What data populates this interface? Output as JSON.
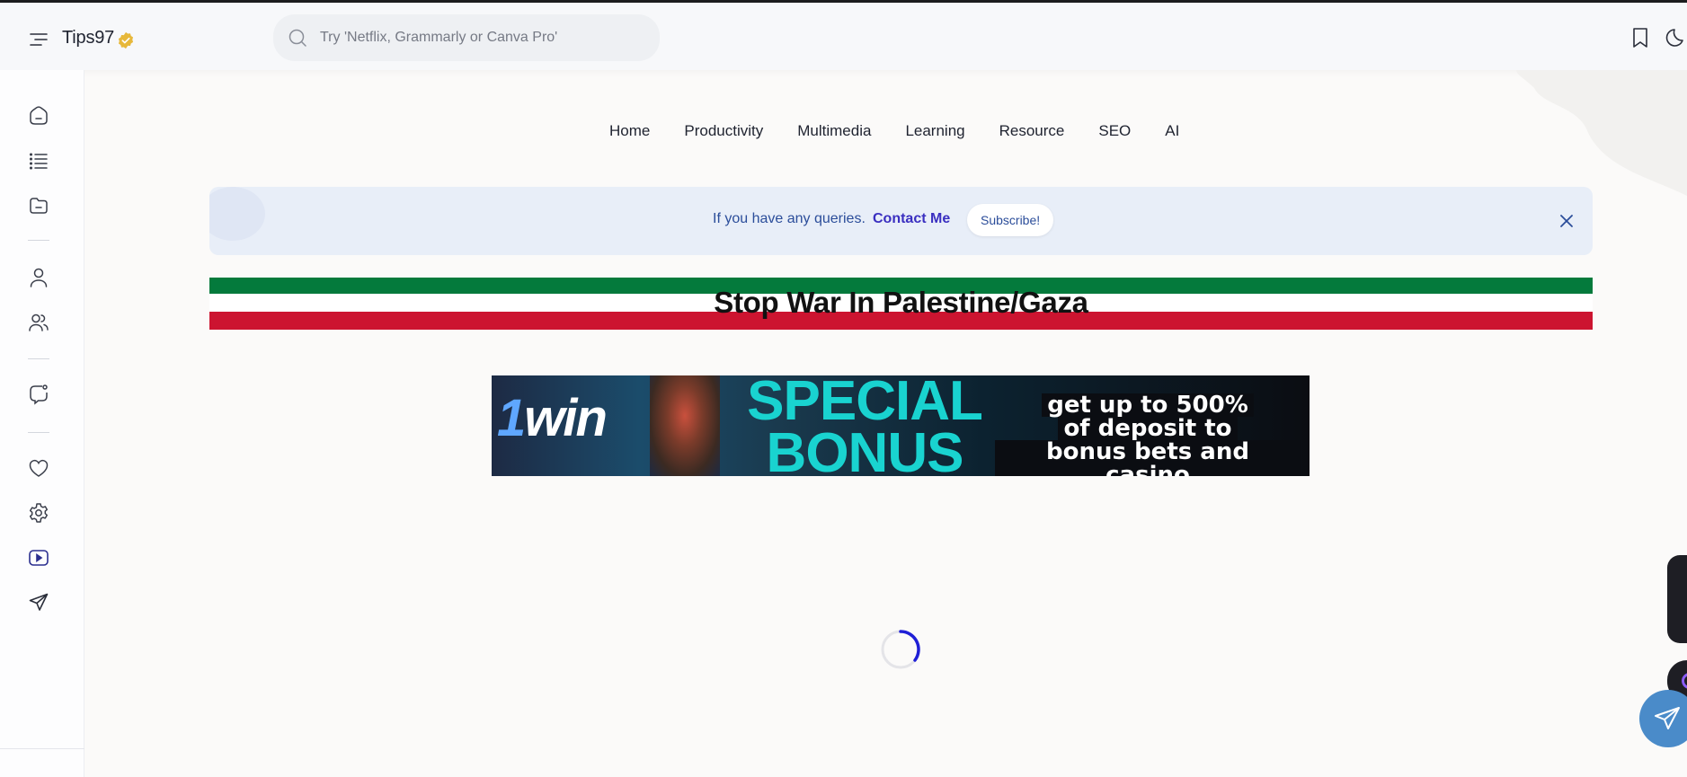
{
  "header": {
    "brand": "Tips97",
    "search_placeholder": "Try 'Netflix, Grammarly or Canva Pro'"
  },
  "nav": {
    "items": [
      "Home",
      "Productivity",
      "Multimedia",
      "Learning",
      "Resource",
      "SEO",
      "AI"
    ]
  },
  "notice": {
    "text": "If you have any queries.",
    "link": "Contact Me",
    "subscribe": "Subscribe!"
  },
  "banner": {
    "title": "Stop War In Palestine/Gaza"
  },
  "ad": {
    "logo_num": "1",
    "logo_word": "win",
    "headline_1": "SPECIAL",
    "headline_2": "BONUS",
    "line_1": "get up to 500%",
    "line_2": "of deposit to",
    "line_3": "bonus bets and casino"
  },
  "colors": {
    "accent": "#3a2fc0",
    "notice_bg": "#e8eef8",
    "flag_green": "#047a3c",
    "flag_red": "#cc1430",
    "spinner": "#1f1fd6",
    "telegram": "#4a8bc9"
  },
  "icons": {
    "header": [
      "menu-icon",
      "verified-badge-icon",
      "search-icon",
      "bookmark-icon",
      "moon-icon"
    ],
    "sidebar": [
      "home-icon",
      "list-icon",
      "folder-icon",
      "user-icon",
      "users-icon",
      "chat-icon",
      "heart-icon",
      "gear-icon",
      "youtube-icon",
      "send-icon"
    ]
  }
}
